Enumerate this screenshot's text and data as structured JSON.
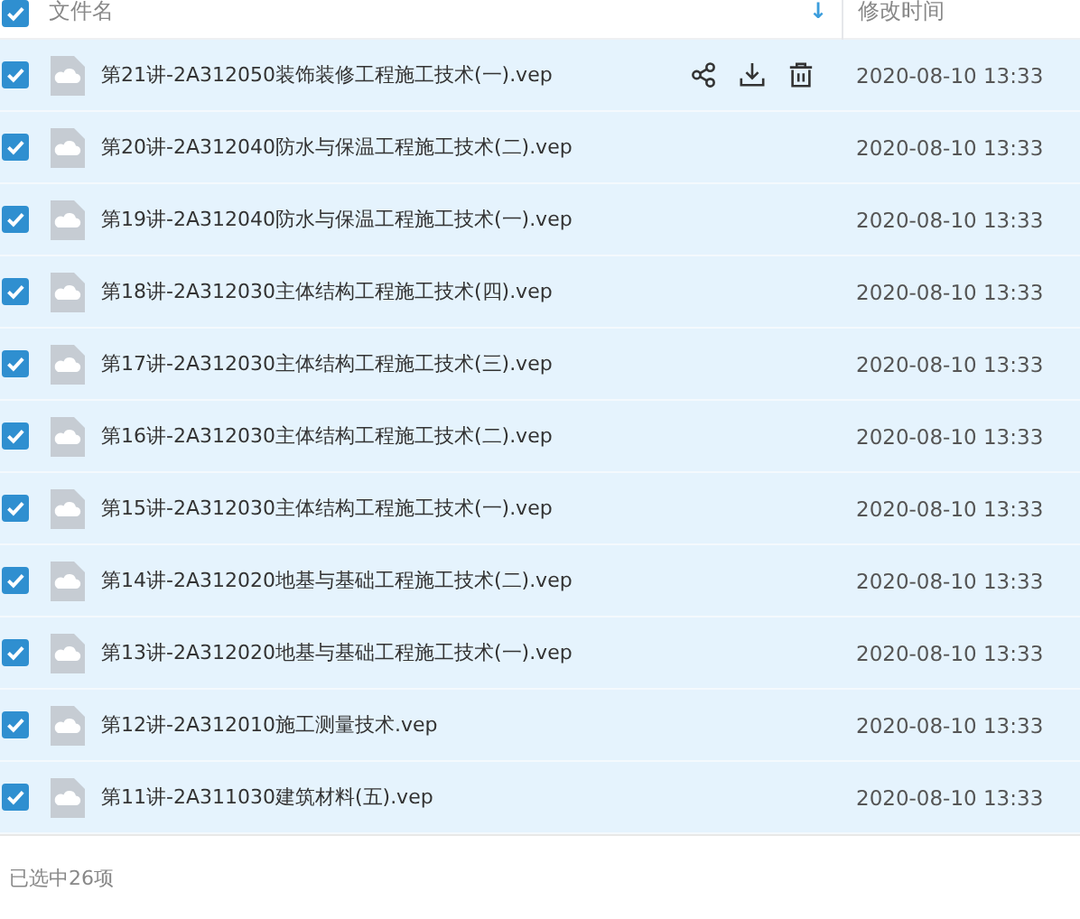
{
  "header": {
    "checked": true,
    "name_column": "文件名",
    "sort_arrow": "↓",
    "date_column": "修改时间"
  },
  "rows": [
    {
      "checked": true,
      "name": "第21讲-2A312050装饰装修工程施工技术(一).vep",
      "date": "2020-08-10 13:33",
      "actions_visible": true
    },
    {
      "checked": true,
      "name": "第20讲-2A312040防水与保温工程施工技术(二).vep",
      "date": "2020-08-10 13:33",
      "actions_visible": false
    },
    {
      "checked": true,
      "name": "第19讲-2A312040防水与保温工程施工技术(一).vep",
      "date": "2020-08-10 13:33",
      "actions_visible": false
    },
    {
      "checked": true,
      "name": "第18讲-2A312030主体结构工程施工技术(四).vep",
      "date": "2020-08-10 13:33",
      "actions_visible": false
    },
    {
      "checked": true,
      "name": "第17讲-2A312030主体结构工程施工技术(三).vep",
      "date": "2020-08-10 13:33",
      "actions_visible": false
    },
    {
      "checked": true,
      "name": "第16讲-2A312030主体结构工程施工技术(二).vep",
      "date": "2020-08-10 13:33",
      "actions_visible": false
    },
    {
      "checked": true,
      "name": "第15讲-2A312030主体结构工程施工技术(一).vep",
      "date": "2020-08-10 13:33",
      "actions_visible": false
    },
    {
      "checked": true,
      "name": "第14讲-2A312020地基与基础工程施工技术(二).vep",
      "date": "2020-08-10 13:33",
      "actions_visible": false
    },
    {
      "checked": true,
      "name": "第13讲-2A312020地基与基础工程施工技术(一).vep",
      "date": "2020-08-10 13:33",
      "actions_visible": false
    },
    {
      "checked": true,
      "name": "第12讲-2A312010施工测量技术.vep",
      "date": "2020-08-10 13:33",
      "actions_visible": false
    },
    {
      "checked": true,
      "name": "第11讲-2A311030建筑材料(五).vep",
      "date": "2020-08-10 13:33",
      "actions_visible": false
    }
  ],
  "status_bar": "已选中26项"
}
